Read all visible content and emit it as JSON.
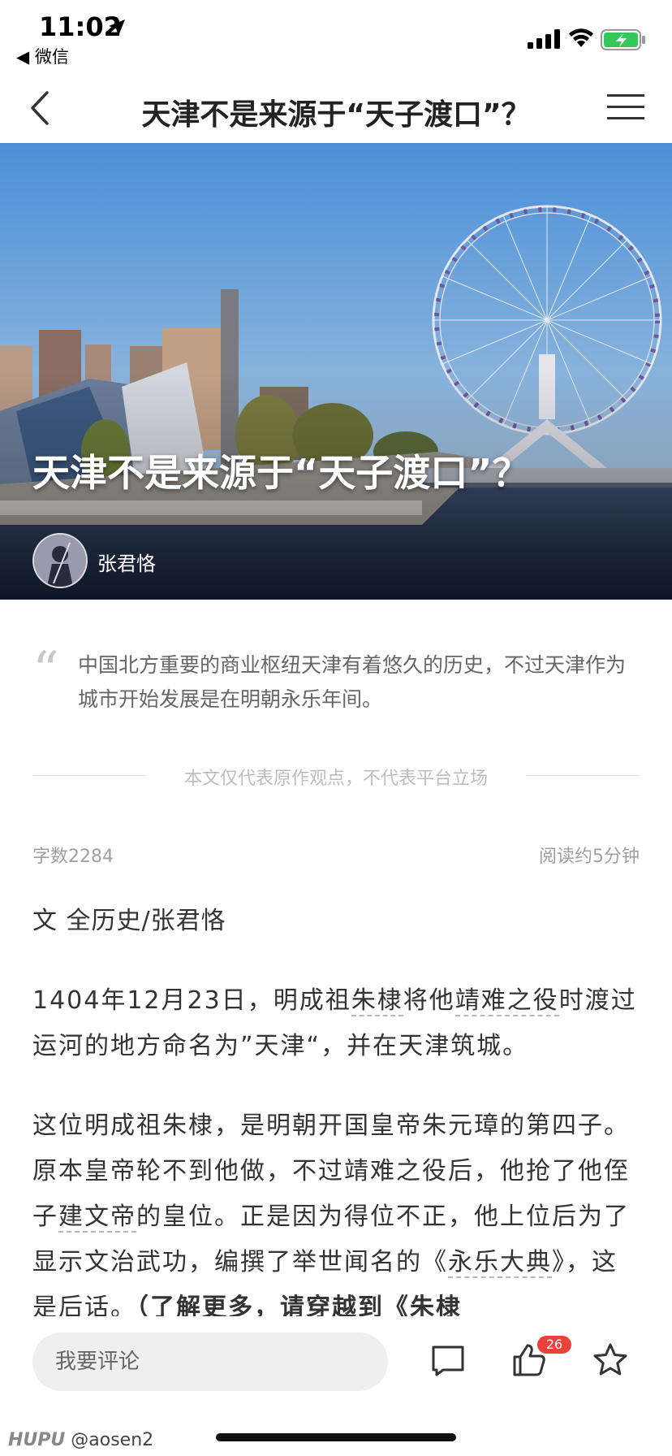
{
  "status_bar": {
    "time": "11:02",
    "back_app": "◀ 微信"
  },
  "nav": {
    "title": "天津不是来源于“天子渡口”？",
    "back_icon": "chevron-left-icon",
    "menu_icon": "hamburger-icon"
  },
  "hero": {
    "title": "天津不是来源于“天子渡口”？",
    "author": "张君恪"
  },
  "quote": {
    "text": "中国北方重要的商业枢纽天津有着悠久的历史，不过天津作为城市开始发展是在明朝永乐年间。"
  },
  "disclaimer": "本文仅代表原作观点，不代表平台立场",
  "meta": {
    "word_count": "字数2284",
    "read_time": "阅读约5分钟"
  },
  "byline": "文 全历史/张君恪",
  "article": {
    "p1": {
      "a": "1404年12月23日，明成祖",
      "l1": "朱棣",
      "b": "将他",
      "l2": "靖难之役",
      "c": "时渡过运河的地方命名为”天津“，并在天津筑城。"
    },
    "p2": {
      "a": "这位明成祖朱棣，是明朝开国皇帝朱元璋的第四子。原本皇帝轮不到他做，不过靖难之役后，他抢了他侄子",
      "l1": "建文帝",
      "b": "的皇位。正是因为得位不正，他上位后为了显示文治武功，编撰了举世闻名的《",
      "l2": "永乐大典",
      "c": "》，这是后话。",
      "bold": "（了解更多，请穿越到《朱棣"
    }
  },
  "bottom_bar": {
    "comment_placeholder": "我要评论",
    "like_count": "26"
  },
  "watermark": {
    "brand": "HUPU",
    "user": "@aosen2"
  },
  "colors": {
    "badge": "#e8433a",
    "sky_top": "#4a8fd8",
    "water": "#1f2f4f"
  }
}
